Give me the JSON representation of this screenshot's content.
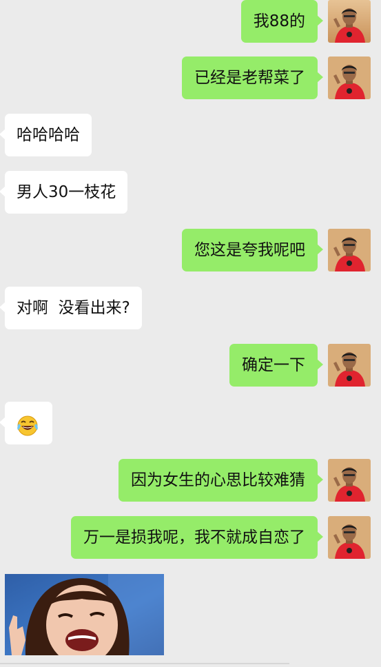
{
  "messages": [
    {
      "side": "out",
      "text": "我88的"
    },
    {
      "side": "out",
      "text": "已经是老帮菜了"
    },
    {
      "side": "in",
      "text": "哈哈哈哈"
    },
    {
      "side": "in",
      "text": "男人30一枝花"
    },
    {
      "side": "out",
      "text": "您这是夸我呢吧"
    },
    {
      "side": "in",
      "text": "对啊  没看出来?"
    },
    {
      "side": "out",
      "text": "确定一下"
    },
    {
      "side": "in",
      "emoji": "tears-of-joy-emoji"
    },
    {
      "side": "out",
      "text": "因为女生的心思比较难猜"
    },
    {
      "side": "out",
      "text": "万一是损我呢，我不就成自恋了"
    },
    {
      "side": "in",
      "image": "laughing-girl-sticker"
    }
  ],
  "colors": {
    "background": "#ebebeb",
    "outgoing_bubble": "#95ec69",
    "incoming_bubble": "#ffffff",
    "text": "#111111"
  }
}
